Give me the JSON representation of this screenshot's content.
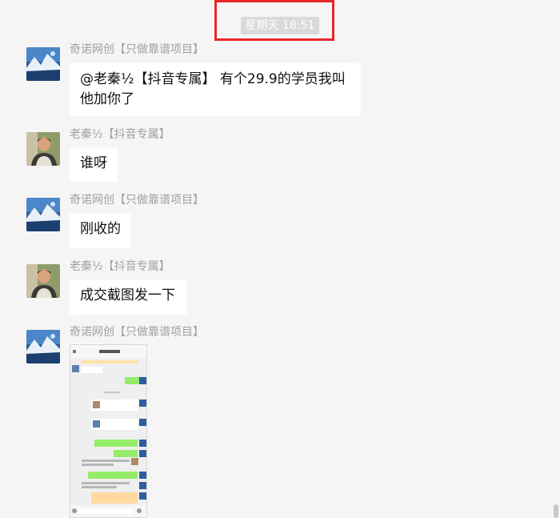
{
  "timestamp": "星期天 18:51",
  "messages": [
    {
      "sender": "奇诺网创【只做靠谱项目】",
      "text": "@老秦½【抖音专属】 有个29.9的学员我叫他加你了"
    },
    {
      "sender": "老秦½【抖音专属】",
      "text": "谁呀"
    },
    {
      "sender": "奇诺网创【只做靠谱项目】",
      "text": "刚收的"
    },
    {
      "sender": "老秦½【抖音专属】",
      "text": "成交截图发一下"
    },
    {
      "sender": "奇诺网创【只做靠谱项目】",
      "image": "chat-screenshot-thumbnail"
    }
  ],
  "colors": {
    "highlight_box": "#e8262a",
    "background": "#f5f5f5",
    "bubble": "#ffffff",
    "name": "#a0a0a0",
    "green_bubble": "#95ec69"
  }
}
